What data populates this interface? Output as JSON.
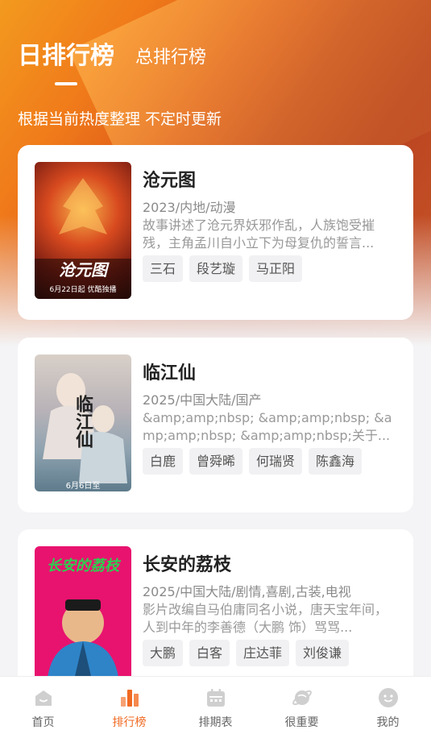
{
  "header": {
    "tab_daily": "日排行榜",
    "tab_total": "总排行榜",
    "subtitle": "根据当前热度整理 不定时更新"
  },
  "items": [
    {
      "title": "沧元图",
      "meta": "2023/内地/动漫",
      "desc": "故事讲述了沧元界妖邪作乱，人族饱受摧残，主角孟川自小立下为母复仇的誓言...",
      "tags": [
        "三石",
        "段艺璇",
        "马正阳"
      ],
      "poster_text": "沧元图",
      "poster_sub": "6月22日起 优酷独播"
    },
    {
      "title": "临江仙",
      "meta": "2025/中国大陆/国产",
      "desc": "&amp;amp;nbsp; &amp;amp;nbsp; &amp;amp;nbsp; &amp;amp;nbsp;关于...",
      "tags": [
        "白鹿",
        "曾舜晞",
        "何瑞贤",
        "陈鑫海"
      ],
      "poster_text": "临江仙",
      "poster_sub": "6月6日至"
    },
    {
      "title": "长安的荔枝",
      "meta": "2025/中国大陆/剧情,喜剧,古装,电视",
      "desc": "影片改编自马伯庸同名小说，唐天宝年间，人到中年的李善德（大鹏 饰）骂骂...",
      "tags": [
        "大鹏",
        "白客",
        "庄达菲",
        "刘俊谦"
      ],
      "poster_text": "长安的荔枝",
      "poster_sub": ""
    }
  ],
  "nav": [
    {
      "label": "首页",
      "icon": "home-icon"
    },
    {
      "label": "排行榜",
      "icon": "ranking-icon"
    },
    {
      "label": "排期表",
      "icon": "calendar-icon"
    },
    {
      "label": "很重要",
      "icon": "planet-icon"
    },
    {
      "label": "我的",
      "icon": "profile-icon"
    }
  ],
  "colors": {
    "accent": "#f06a23",
    "nav_inactive": "#c9c9c9"
  }
}
